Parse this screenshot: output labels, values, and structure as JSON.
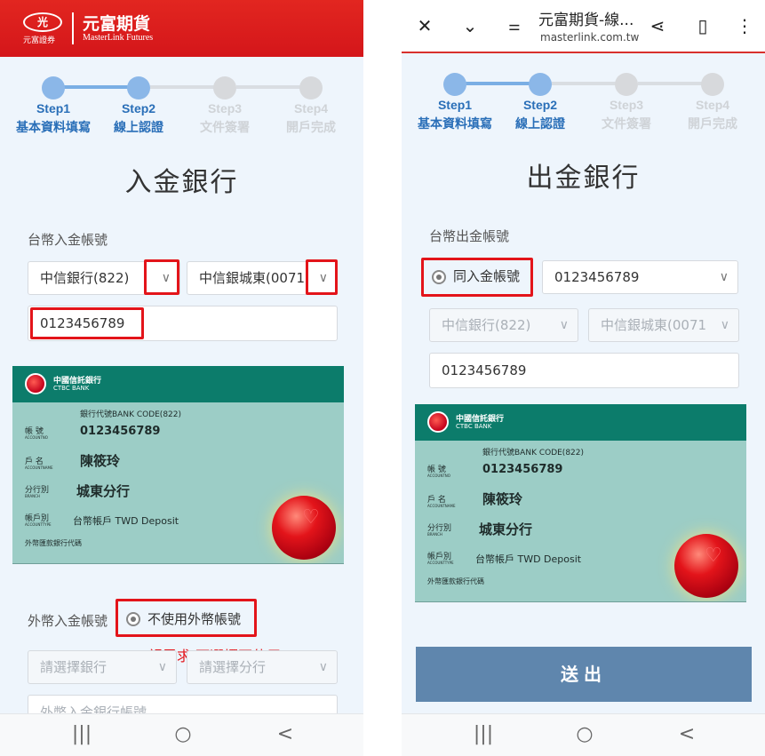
{
  "left": {
    "header": {
      "logo_mark": "光",
      "logo_sub": "元富證券",
      "brand_name": "元富期貨",
      "brand_en": "MasterLink Futures"
    },
    "steps": [
      {
        "name": "Step1",
        "desc": "基本資料填寫",
        "state": "done"
      },
      {
        "name": "Step2",
        "desc": "線上認證",
        "state": "done"
      },
      {
        "name": "Step3",
        "desc": "文件簽署",
        "state": "todo"
      },
      {
        "name": "Step4",
        "desc": "開戶完成",
        "state": "todo"
      }
    ],
    "title": "入金銀行",
    "twd_label": "台幣入金帳號",
    "bank_select": "中信銀行(822)",
    "branch_select": "中信銀城東(0071",
    "account_value": "0123456789",
    "fx_label": "外幣入金帳號",
    "fx_radio_label": "不使用外幣帳號",
    "fx_note": "*視需求 可選擇不使用",
    "fx_bank_placeholder": "請選擇銀行",
    "fx_branch_placeholder": "請選擇分行",
    "fx_account_placeholder": "外幣入金銀行帳號"
  },
  "right": {
    "browser": {
      "page_title": "元富期貨-線...",
      "url": "masterlink.com.tw"
    },
    "steps": [
      {
        "name": "Step1",
        "desc": "基本資料填寫",
        "state": "done"
      },
      {
        "name": "Step2",
        "desc": "線上認證",
        "state": "done"
      },
      {
        "name": "Step3",
        "desc": "文件簽署",
        "state": "todo"
      },
      {
        "name": "Step4",
        "desc": "開戶完成",
        "state": "todo"
      }
    ],
    "title": "出金銀行",
    "twd_label": "台幣出金帳號",
    "same_radio_label": "同入金帳號",
    "account_select": "0123456789",
    "bank_select": "中信銀行(822)",
    "branch_select": "中信銀城東(0071",
    "account_value": "0123456789",
    "submit": "送出"
  },
  "card": {
    "bank_name": "中國信託銀行",
    "bank_en": "CTBC BANK",
    "code_line": "銀行代號BANK CODE(822)",
    "acct_label": "帳 號",
    "acct_label_en": "ACCOUNTNO",
    "acct_no": "0123456789",
    "holder_label": "戶 名",
    "holder_label_en": "ACCOUNTNAME",
    "holder": "陳筱玲",
    "branch_label": "分行別",
    "branch_label_en": "BRANCH",
    "branch": "城東分行",
    "type_label": "帳戶別",
    "type_label_en": "ACCOUNTTYPE",
    "type": "台幣帳戶 TWD Deposit",
    "footer": "外幣匯款銀行代碼"
  },
  "navbar": {
    "recents": "|||",
    "home": "○",
    "back": "<"
  },
  "colors": {
    "brand_red": "#d4161a",
    "step_active": "#8bb7e8",
    "highlight": "#e3141a",
    "submit_bg": "#5f86ad",
    "card_bg": "#9ccdc6",
    "card_head": "#0c7c6b"
  }
}
